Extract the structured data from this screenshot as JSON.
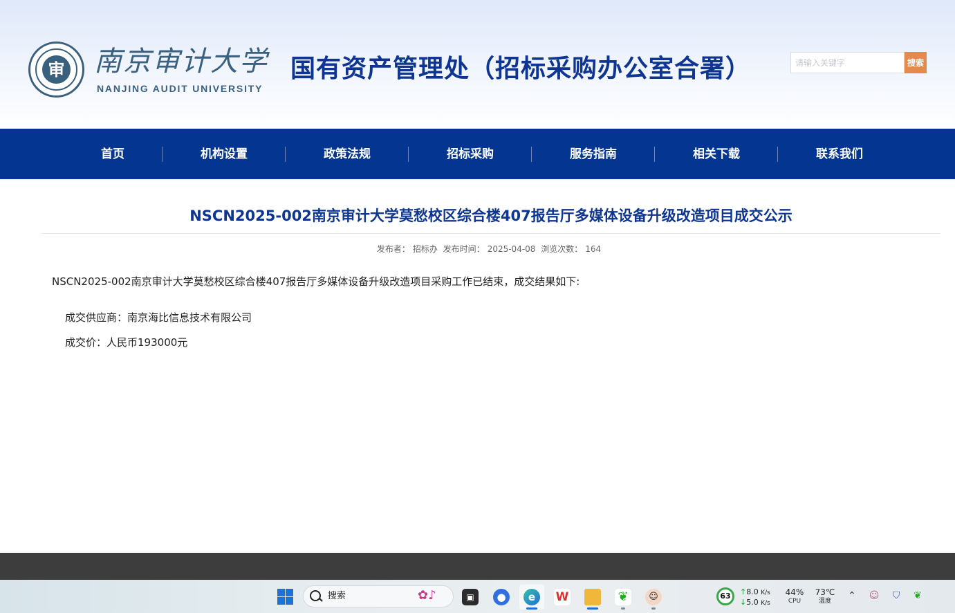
{
  "header": {
    "logo_cn": "南京审计大学",
    "logo_en": "NANJING AUDIT UNIVERSITY",
    "logo_seal_char": "审",
    "dept_title": "国有资产管理处（招标采购办公室合署）",
    "search_placeholder": "请输入关键字",
    "search_button": "搜索"
  },
  "nav": {
    "items": [
      "首页",
      "机构设置",
      "政策法规",
      "招标采购",
      "服务指南",
      "相关下载",
      "联系我们"
    ]
  },
  "article": {
    "title": "NSCN2025-002南京审计大学莫愁校区综合楼407报告厅多媒体设备升级改造项目成交公示",
    "meta_publisher_label": "发布者：",
    "meta_publisher": "招标办",
    "meta_date_label": "发布时间：",
    "meta_date": "2025-04-08",
    "meta_views_label": "浏览次数：",
    "meta_views": "164",
    "intro": "NSCN2025-002南京审计大学莫愁校区综合楼407报告厅多媒体设备升级改造项目采购工作已结束，成交结果如下:",
    "supplier_label": "成交供应商：",
    "supplier": "南京海比信息技术有限公司",
    "price_label": "成交价：",
    "price": "人民币193000元"
  },
  "taskbar": {
    "search_text": "搜索",
    "apps": [
      "task-view",
      "browser-alt",
      "edge",
      "wps",
      "file-explorer",
      "wechat",
      "avatar-app"
    ],
    "gauge_value": "63",
    "net_up": "8.0",
    "net_up_unit": "K/s",
    "net_down": "5.0",
    "net_down_unit": "K/s",
    "cpu_value": "44%",
    "cpu_label": "CPU",
    "temp_value": "73℃",
    "temp_label": "温度",
    "colors": {
      "accent_blue": "#033591",
      "search_orange": "#e48a4d",
      "gauge_green": "#3aa64a"
    }
  }
}
